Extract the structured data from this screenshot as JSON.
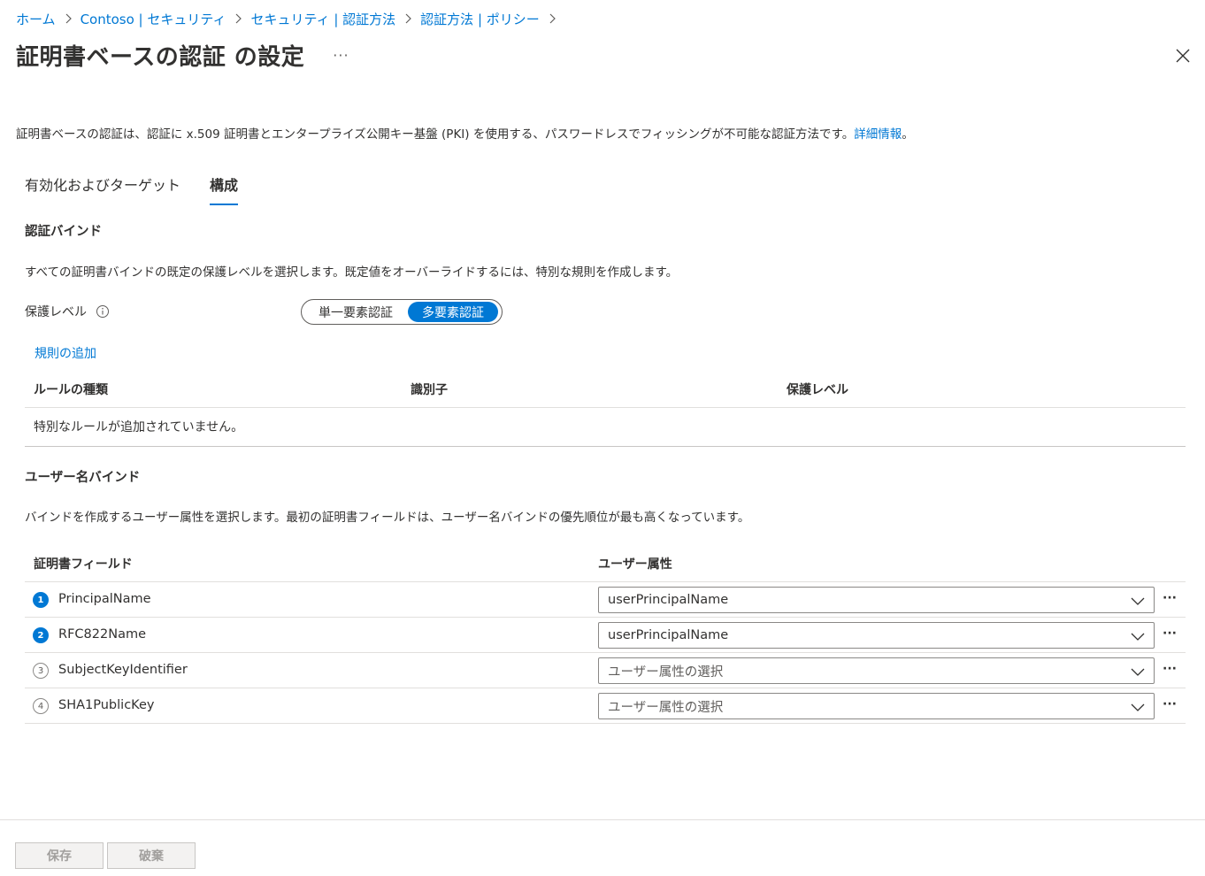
{
  "breadcrumb": {
    "items": [
      "ホーム",
      "Contoso | セキュリティ",
      "セキュリティ | 認証方法",
      "認証方法 | ポリシー"
    ]
  },
  "header": {
    "title": "証明書ベースの認証 の設定",
    "more": "···"
  },
  "description": {
    "text": "証明書ベースの認証は、認証に x.509 証明書とエンタープライズ公開キー基盤 (PKI) を使用する、パスワードレスでフィッシングが不可能な認証方法です。",
    "link": "詳細情報",
    "end": "。"
  },
  "tabs": [
    {
      "label": "有効化およびターゲット",
      "active": false
    },
    {
      "label": "構成",
      "active": true
    }
  ],
  "auth_binding": {
    "title": "認証バインド",
    "description": "すべての証明書バインドの既定の保護レベルを選択します。既定値をオーバーライドするには、特別な規則を作成します。",
    "protection_label": "保護レベル",
    "options": [
      "単一要素認証",
      "多要素認証"
    ],
    "selected": "多要素認証",
    "add_rule": "規則の追加",
    "columns": [
      "ルールの種類",
      "識別子",
      "保護レベル"
    ],
    "empty_text": "特別なルールが追加されていません。"
  },
  "username_binding": {
    "title": "ユーザー名バインド",
    "description": "バインドを作成するユーザー属性を選択します。最初の証明書フィールドは、ユーザー名バインドの優先順位が最も高くなっています。",
    "columns": [
      "証明書フィールド",
      "ユーザー属性"
    ],
    "rows": [
      {
        "num": "1",
        "field": "PrincipalName",
        "value": "userPrincipalName",
        "placeholder": false
      },
      {
        "num": "2",
        "field": "RFC822Name",
        "value": "userPrincipalName",
        "placeholder": false
      },
      {
        "num": "3",
        "field": "SubjectKeyIdentifier",
        "value": "ユーザー属性の選択",
        "placeholder": true
      },
      {
        "num": "4",
        "field": "SHA1PublicKey",
        "value": "ユーザー属性の選択",
        "placeholder": true
      }
    ],
    "row_more": "···"
  },
  "footer": {
    "save": "保存",
    "discard": "破棄"
  },
  "colors": {
    "accent": "#0078d4",
    "text": "#323130",
    "border": "#e1dfdd"
  }
}
